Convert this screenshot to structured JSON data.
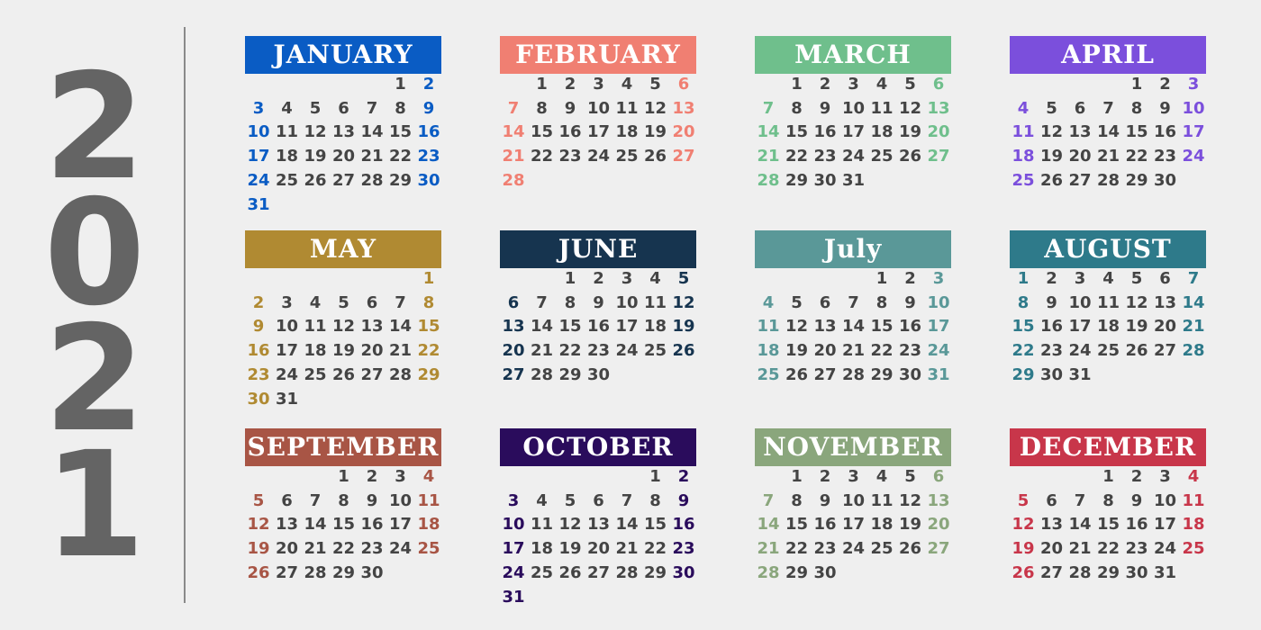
{
  "year": {
    "digits": [
      "2",
      "0",
      "2",
      "1"
    ],
    "color": "#646464"
  },
  "week_start": "Sunday",
  "months": [
    {
      "name": "JANUARY",
      "color": "#0a5cc4",
      "days": 31,
      "first_weekday": 5
    },
    {
      "name": "FEBRUARY",
      "color": "#f07f72",
      "days": 28,
      "first_weekday": 1
    },
    {
      "name": "MARCH",
      "color": "#6fbf8c",
      "days": 31,
      "first_weekday": 1
    },
    {
      "name": "APRIL",
      "color": "#7b4fdc",
      "days": 30,
      "first_weekday": 4
    },
    {
      "name": "MAY",
      "color": "#b08a32",
      "days": 31,
      "first_weekday": 6
    },
    {
      "name": "JUNE",
      "color": "#16344f",
      "days": 30,
      "first_weekday": 2
    },
    {
      "name": "July",
      "color": "#5a9898",
      "days": 31,
      "first_weekday": 4
    },
    {
      "name": "AUGUST",
      "color": "#2e7a8a",
      "days": 31,
      "first_weekday": 0
    },
    {
      "name": "SEPTEMBER",
      "color": "#a85545",
      "days": 30,
      "first_weekday": 3
    },
    {
      "name": "OCTOBER",
      "color": "#2a0c5c",
      "days": 31,
      "first_weekday": 5
    },
    {
      "name": "NOVEMBER",
      "color": "#8aa67c",
      "days": 30,
      "first_weekday": 1
    },
    {
      "name": "DECEMBER",
      "color": "#c8364a",
      "days": 31,
      "first_weekday": 3
    }
  ]
}
